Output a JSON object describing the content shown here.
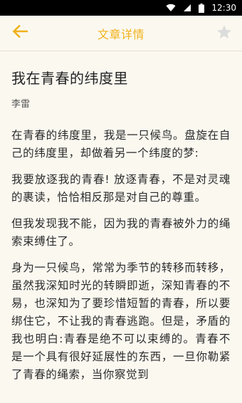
{
  "status_bar": {
    "time": "12:30"
  },
  "header": {
    "title": "文章详情"
  },
  "icons": {
    "back": "back-arrow-icon",
    "favorite": "star-icon",
    "wifi": "wifi-icon",
    "signal": "cell-signal-icon",
    "battery": "battery-icon"
  },
  "colors": {
    "accent": "#f0b21c",
    "background": "#fbf8f0"
  },
  "article": {
    "title": "我在青春的纬度里",
    "author": "李雷",
    "paragraphs": [
      "在青春的纬度里，我是一只候鸟。盘旋在自己的纬度里，却做着另一个纬度的梦:",
      "我要放逐我的青春! 放逐青春，不是对灵魂的裹读，恰恰相反那是对自己的尊重。",
      "但我发现我不能，因为我的青春被外力的绳索束缚住了。",
      "身为一只候鸟，常常为季节的转移而转移，虽然我深知时光的转瞬即逝，深知青春的不易，也深知为了要珍惜短暂的青春，所以要绑住它，不让我的青春逃跑。但是，矛盾的我也明白:青春是绝不可以束缚的。青春不是一个具有很好延展性的东西，一旦你勒紧了青春的绳索，当你察觉到"
    ]
  }
}
